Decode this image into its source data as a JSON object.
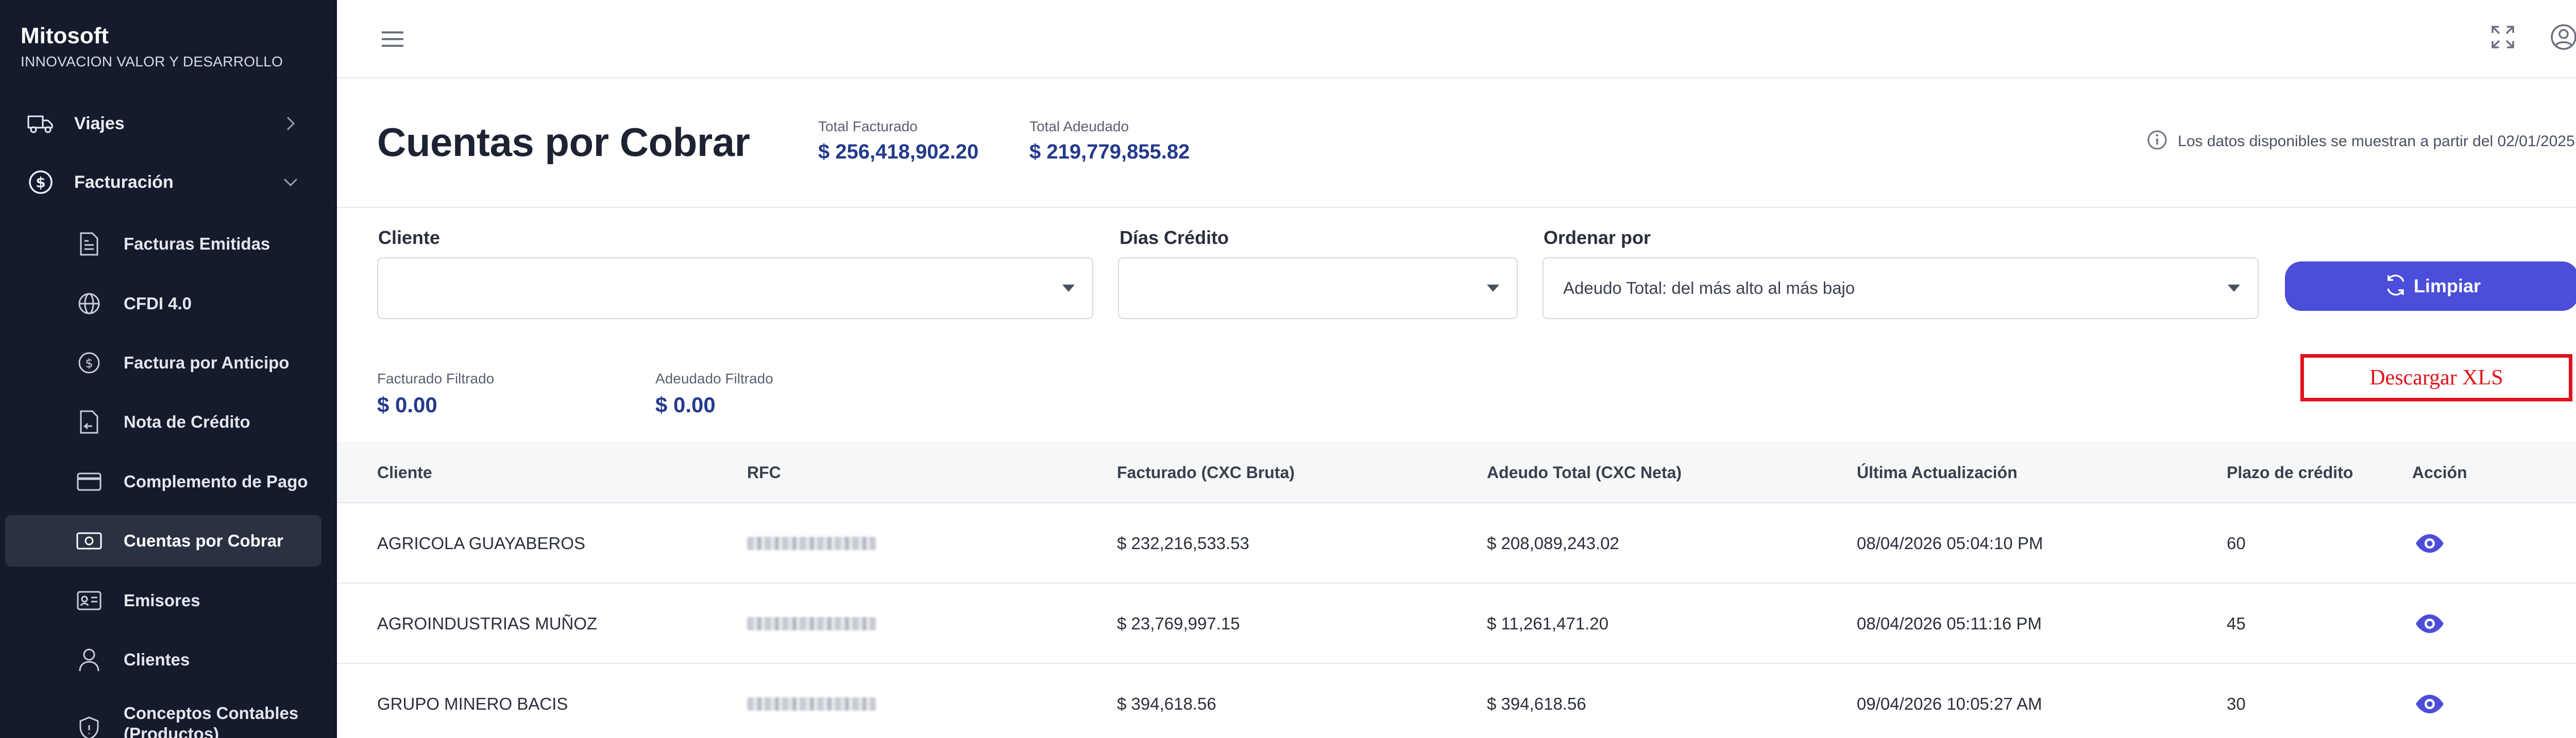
{
  "brand": {
    "name": "Mitosoft",
    "tagline": "INNOVACION VALOR Y DESARROLLO"
  },
  "sidebar": {
    "items": [
      {
        "label": "Viajes",
        "icon": "truck-icon"
      },
      {
        "label": "Facturación",
        "icon": "dollar-circle-icon"
      }
    ],
    "subitems": [
      {
        "label": "Facturas Emitidas",
        "icon": "document-icon"
      },
      {
        "label": "CFDI 4.0",
        "icon": "globe-icon"
      },
      {
        "label": "Factura por Anticipo",
        "icon": "dollar-circle-icon"
      },
      {
        "label": "Nota de Crédito",
        "icon": "note-return-icon"
      },
      {
        "label": "Complemento de Pago",
        "icon": "credit-card-icon"
      },
      {
        "label": "Cuentas por Cobrar",
        "icon": "cash-icon",
        "active": true
      },
      {
        "label": "Emisores",
        "icon": "id-card-icon"
      },
      {
        "label": "Clientes",
        "icon": "user-icon"
      },
      {
        "label": "Conceptos Contables (Productos)",
        "icon": "shield-icon"
      }
    ]
  },
  "header": {
    "title": "Cuentas por Cobrar",
    "total_facturado_label": "Total Facturado",
    "total_facturado_value": "$ 256,418,902.20",
    "total_adeudado_label": "Total Adeudado",
    "total_adeudado_value": "$ 219,779,855.82",
    "info_note": "Los datos disponibles se muestran a partir del 02/01/2025."
  },
  "filters": {
    "cliente_label": "Cliente",
    "cliente_value": "",
    "dias_credito_label": "Días Crédito",
    "dias_credito_value": "",
    "ordenar_label": "Ordenar por",
    "ordenar_value": "Adeudo Total: del más alto al más bajo",
    "limpiar_label": "Limpiar"
  },
  "filtered": {
    "facturado_label": "Facturado Filtrado",
    "facturado_value": "$ 0.00",
    "adeudado_label": "Adeudado Filtrado",
    "adeudado_value": "$ 0.00"
  },
  "download_label": "Descargar XLS",
  "table": {
    "columns": [
      "Cliente",
      "RFC",
      "Facturado (CXC Bruta)",
      "Adeudo Total (CXC Neta)",
      "Última Actualización",
      "Plazo de crédito",
      "Acción"
    ],
    "rows": [
      {
        "cliente": "AGRICOLA GUAYABEROS",
        "facturado": "$ 232,216,533.53",
        "adeudo": "$ 208,089,243.02",
        "actualizacion": "08/04/2026 05:04:10 PM",
        "plazo": "60"
      },
      {
        "cliente": "AGROINDUSTRIAS MUÑOZ",
        "facturado": "$ 23,769,997.15",
        "adeudo": "$ 11,261,471.20",
        "actualizacion": "08/04/2026 05:11:16 PM",
        "plazo": "45"
      },
      {
        "cliente": "GRUPO MINERO BACIS",
        "facturado": "$ 394,618.56",
        "adeudo": "$ 394,618.56",
        "actualizacion": "09/04/2026 10:05:27 AM",
        "plazo": "30"
      }
    ]
  },
  "colors": {
    "sidebar_bg": "#151b2c",
    "accent": "#4b4ed9",
    "money": "#233a8c",
    "download_red": "#e0121b"
  }
}
